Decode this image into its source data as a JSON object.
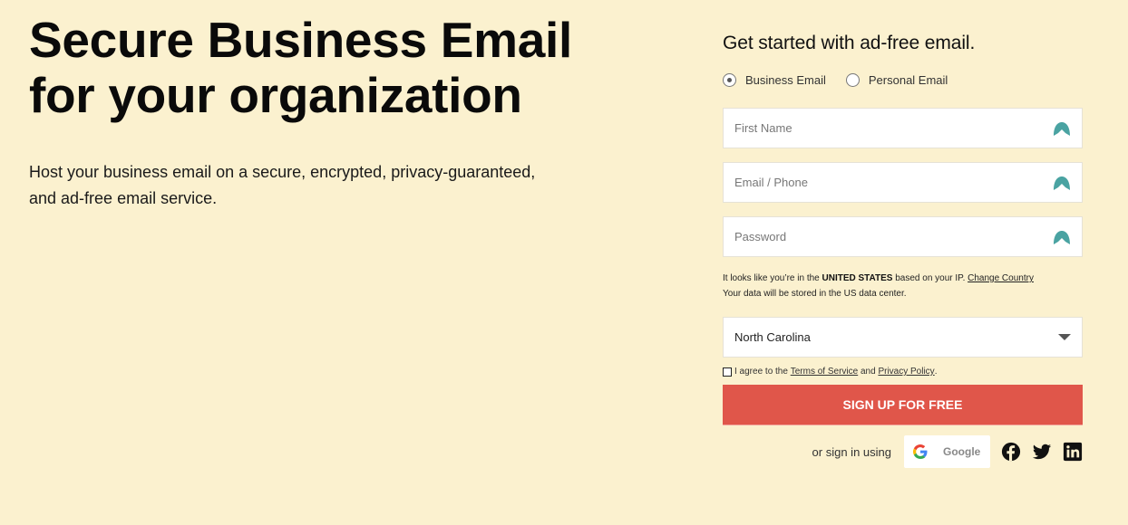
{
  "hero": {
    "title_line1": "Secure Business Email",
    "title_line2": "for your organization",
    "subtitle_line1": "Host your business email on a secure, encrypted, privacy-guaranteed,",
    "subtitle_line2": "and ad-free email service."
  },
  "form": {
    "title": "Get started with ad-free email.",
    "account_types": [
      {
        "label": "Business Email",
        "selected": true
      },
      {
        "label": "Personal Email",
        "selected": false
      }
    ],
    "fields": {
      "first_name": {
        "placeholder": "First Name",
        "value": "",
        "icon": "lock-icon"
      },
      "email_phone": {
        "placeholder": "Email / Phone",
        "value": "",
        "icon": "lock-icon"
      },
      "password": {
        "placeholder": "Password",
        "value": "",
        "icon": "lock-icon"
      }
    },
    "ip_note": {
      "prefix": "It looks like you’re in the ",
      "country": "UNITED STATES",
      "suffix": " based on your IP. ",
      "change_link": "Change Country",
      "line2": "Your data will be stored in the US data center."
    },
    "region_select": {
      "selected": "North Carolina"
    },
    "agree": {
      "checked": false,
      "prefix": "I agree to the ",
      "terms_link": "Terms of Service",
      "middle": " and ",
      "privacy_link": "Privacy Policy",
      "suffix": "."
    },
    "signup_label": "SIGN UP FOR FREE",
    "social": {
      "label": "or sign in using",
      "google_label": "Google",
      "icons": [
        "facebook-icon",
        "twitter-icon",
        "linkedin-icon"
      ]
    }
  },
  "colors": {
    "background": "#fbf1cf",
    "signup_button": "#e0564a",
    "lock_icon": "#4aa3a2"
  }
}
